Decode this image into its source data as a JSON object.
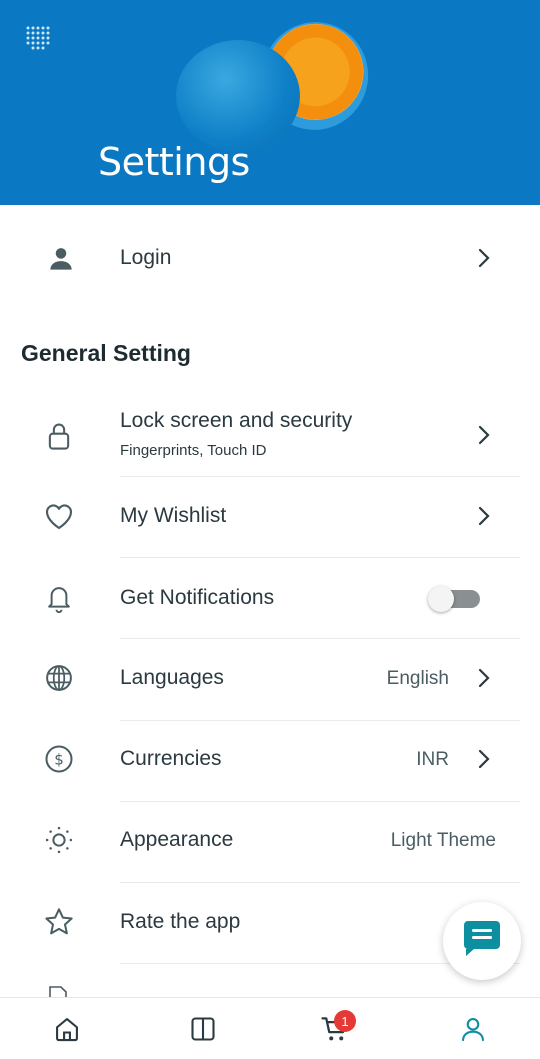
{
  "header": {
    "title": "Settings",
    "menu_icon": "dots-grid-icon"
  },
  "login": {
    "label": "Login",
    "icon": "person-icon"
  },
  "general": {
    "title": "General Setting",
    "items": [
      {
        "label": "Lock screen and security",
        "sub": "Fingerprints, Touch ID",
        "icon": "lock-icon",
        "value": ""
      },
      {
        "label": "My Wishlist",
        "icon": "heart-icon",
        "value": ""
      },
      {
        "label": "Get Notifications",
        "icon": "bell-icon",
        "value": "",
        "toggle_on": false
      },
      {
        "label": "Languages",
        "icon": "globe-icon",
        "value": "English"
      },
      {
        "label": "Currencies",
        "icon": "dollar-circle-icon",
        "value": "INR"
      },
      {
        "label": "Appearance",
        "icon": "sun-icon",
        "value": "Light Theme"
      },
      {
        "label": "Rate the app",
        "icon": "star-icon",
        "value": ""
      }
    ]
  },
  "chat_fab": {
    "icon": "chat-icon"
  },
  "bottom_nav": {
    "items": [
      {
        "name": "home",
        "icon": "home-icon"
      },
      {
        "name": "split",
        "icon": "split-view-icon"
      },
      {
        "name": "cart",
        "icon": "cart-icon",
        "badge": "1"
      },
      {
        "name": "profile",
        "icon": "profile-icon"
      }
    ]
  },
  "colors": {
    "header_bg": "#0a78c2",
    "accent": "#0e8fa0",
    "text": "#2b3a40",
    "badge": "#e53935"
  }
}
